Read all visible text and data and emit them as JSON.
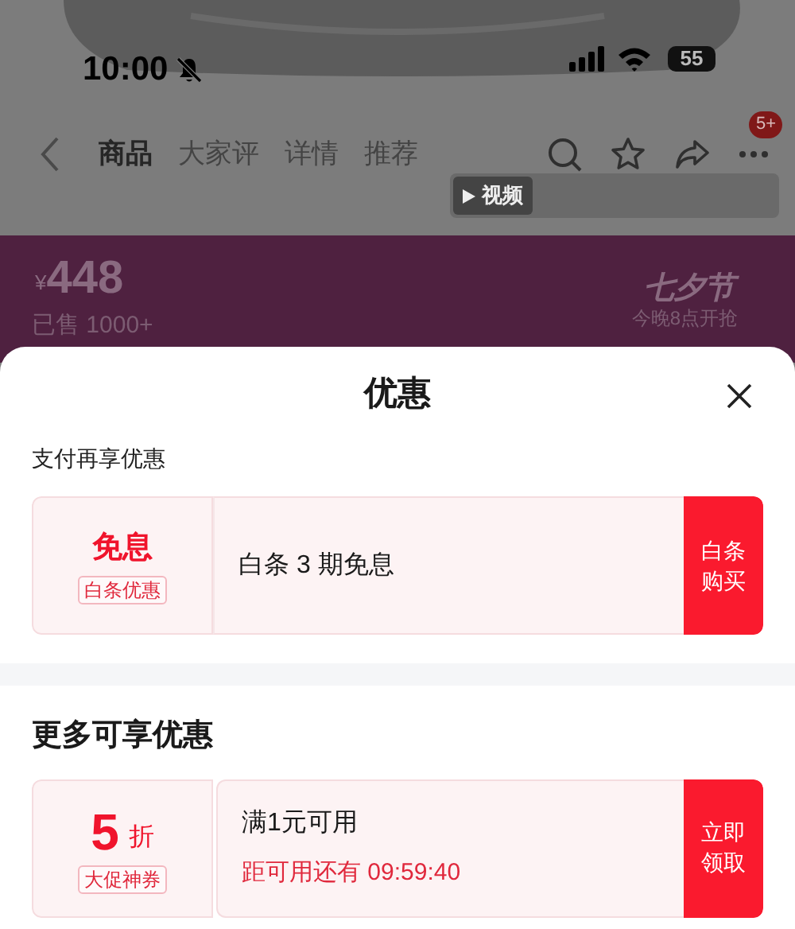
{
  "status_bar": {
    "time": "10:00",
    "battery": "55"
  },
  "nav": {
    "tabs": [
      {
        "label": "商品",
        "selected": true
      },
      {
        "label": "大家评",
        "selected": false
      },
      {
        "label": "详情",
        "selected": false
      },
      {
        "label": "推荐",
        "selected": false
      }
    ],
    "badge": "5+"
  },
  "media_tabs": [
    {
      "label": "视频",
      "selected": true
    }
  ],
  "price": {
    "currency": "¥",
    "amount": "448",
    "sold": "已售 1000+"
  },
  "promo": {
    "title": "七夕节",
    "subtitle": "今晚8点开抢"
  },
  "sheet": {
    "title": "优惠",
    "sections": [
      {
        "heading": "支付再享优惠",
        "kind": "plain",
        "coupons": [
          {
            "value": "免息",
            "tag": "白条优惠",
            "text": "白条 3 期免息",
            "button": "白条购买"
          }
        ]
      },
      {
        "heading": "更多可享优惠",
        "kind": "bold",
        "coupons": [
          {
            "value": "5",
            "unit": "折",
            "tag": "大促神券",
            "text": "满1元可用",
            "countdown": "距可用还有 09:59:40",
            "button": "立即领取"
          }
        ]
      }
    ]
  }
}
